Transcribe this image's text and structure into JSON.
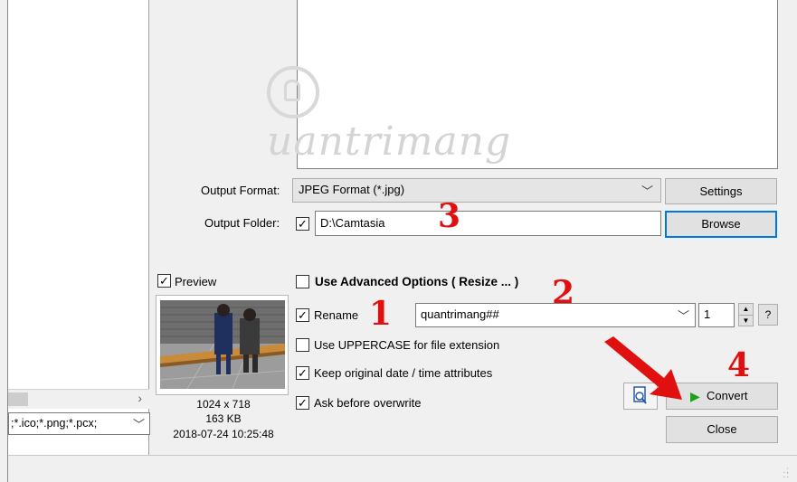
{
  "filter": {
    "value": ";*.ico;*.png;*.pcx;",
    "chevron": "chevron-down-icon"
  },
  "watermark": {
    "text": "uantrimang"
  },
  "output": {
    "format_label": "Output Format:",
    "format_value": "JPEG Format (*.jpg)",
    "settings_label": "Settings",
    "folder_label": "Output Folder:",
    "folder_checked": true,
    "folder_value": "D:\\Camtasia",
    "browse_label": "Browse"
  },
  "preview": {
    "label": "Preview",
    "checked": true,
    "dimensions": "1024 x 718",
    "size": "163 KB",
    "date": "2018-07-24 10:25:48"
  },
  "options": {
    "advanced_label": "Use Advanced Options ( Resize ... )",
    "advanced_checked": false,
    "rename_label": "Rename",
    "rename_checked": true,
    "rename_value": "quantrimang##",
    "rename_start": "1",
    "help": "?",
    "uppercase_label": "Use UPPERCASE for file extension",
    "uppercase_checked": false,
    "keep_date_label": "Keep original date / time attributes",
    "keep_date_checked": true,
    "overwrite_label": "Ask before overwrite",
    "overwrite_checked": true
  },
  "actions": {
    "convert_label": "Convert",
    "close_label": "Close"
  },
  "annotations": {
    "n1": "1",
    "n2": "2",
    "n3": "3",
    "n4": "4"
  },
  "colors": {
    "annotation": "#e01010",
    "accent": "#0078d7",
    "play": "#1aa31a"
  }
}
